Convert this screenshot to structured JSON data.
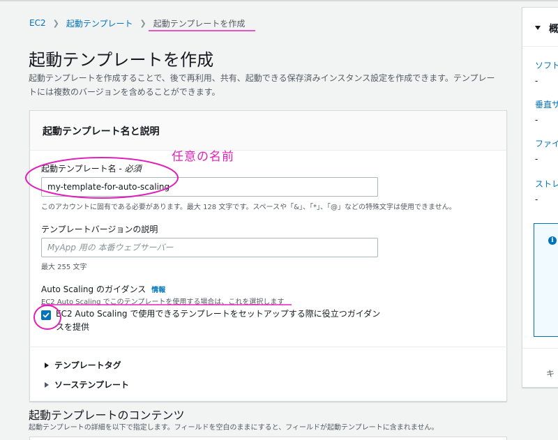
{
  "breadcrumb": {
    "items": [
      "EC2",
      "起動テンプレート"
    ],
    "current": "起動テンプレートを作成"
  },
  "page": {
    "title": "起動テンプレートを作成",
    "description": "起動テンプレートを作成することで、後で再利用、共有、起動できる保存済みインスタンス設定を作成できます。テンプレートには複数のバージョンを含めることができます。"
  },
  "card": {
    "title": "起動テンプレート名と説明",
    "name_label": "起動テンプレート名 - ",
    "name_required": "必須",
    "name_value": "my-template-for-auto-scaling",
    "name_hint": "このアカウントに固有である必要があります。最大 128 文字です。スペースや「&」、「*」、「@」などの特殊文字は使用できません。",
    "version_label": "テンプレートバージョンの説明",
    "version_placeholder": "MyApp 用の 本番ウェブサーバー",
    "version_hint": "最大 255 文字",
    "guidance_label": "Auto Scaling のガイダンス",
    "guidance_info": "情報",
    "guidance_sub": "EC2 Auto Scaling でこのテンプレートを使用する場合は、これを選択します",
    "guidance_checkbox_text": "EC2 Auto Scaling で使用できるテンプレートをセットアップする際に役立つガイダンスを提供",
    "guidance_checked": true,
    "tags_label": "テンプレートタグ",
    "source_label": "ソーステンプレート"
  },
  "section2": {
    "title": "起動テンプレートのコンテンツ",
    "description": "起動テンプレートの詳細を以下で指定します。フィールドを空白のままにすると、フィールドが起動テンプレートに含まれません。"
  },
  "summary_panel": {
    "title": "概",
    "items": [
      {
        "label": "ソフト",
        "value": "-"
      },
      {
        "label": "垂直サ",
        "value": "-"
      },
      {
        "label": "ファイ",
        "value": "-"
      },
      {
        "label": "ストレ",
        "value": "-"
      }
    ],
    "info_icon": "i",
    "cancel": "キ"
  },
  "annotations": {
    "handwritten_note": "任意の名前",
    "color": "#e020b8"
  },
  "colors": {
    "link": "#0073bb",
    "background": "#f2f3f3",
    "annotation": "#e020b8"
  }
}
